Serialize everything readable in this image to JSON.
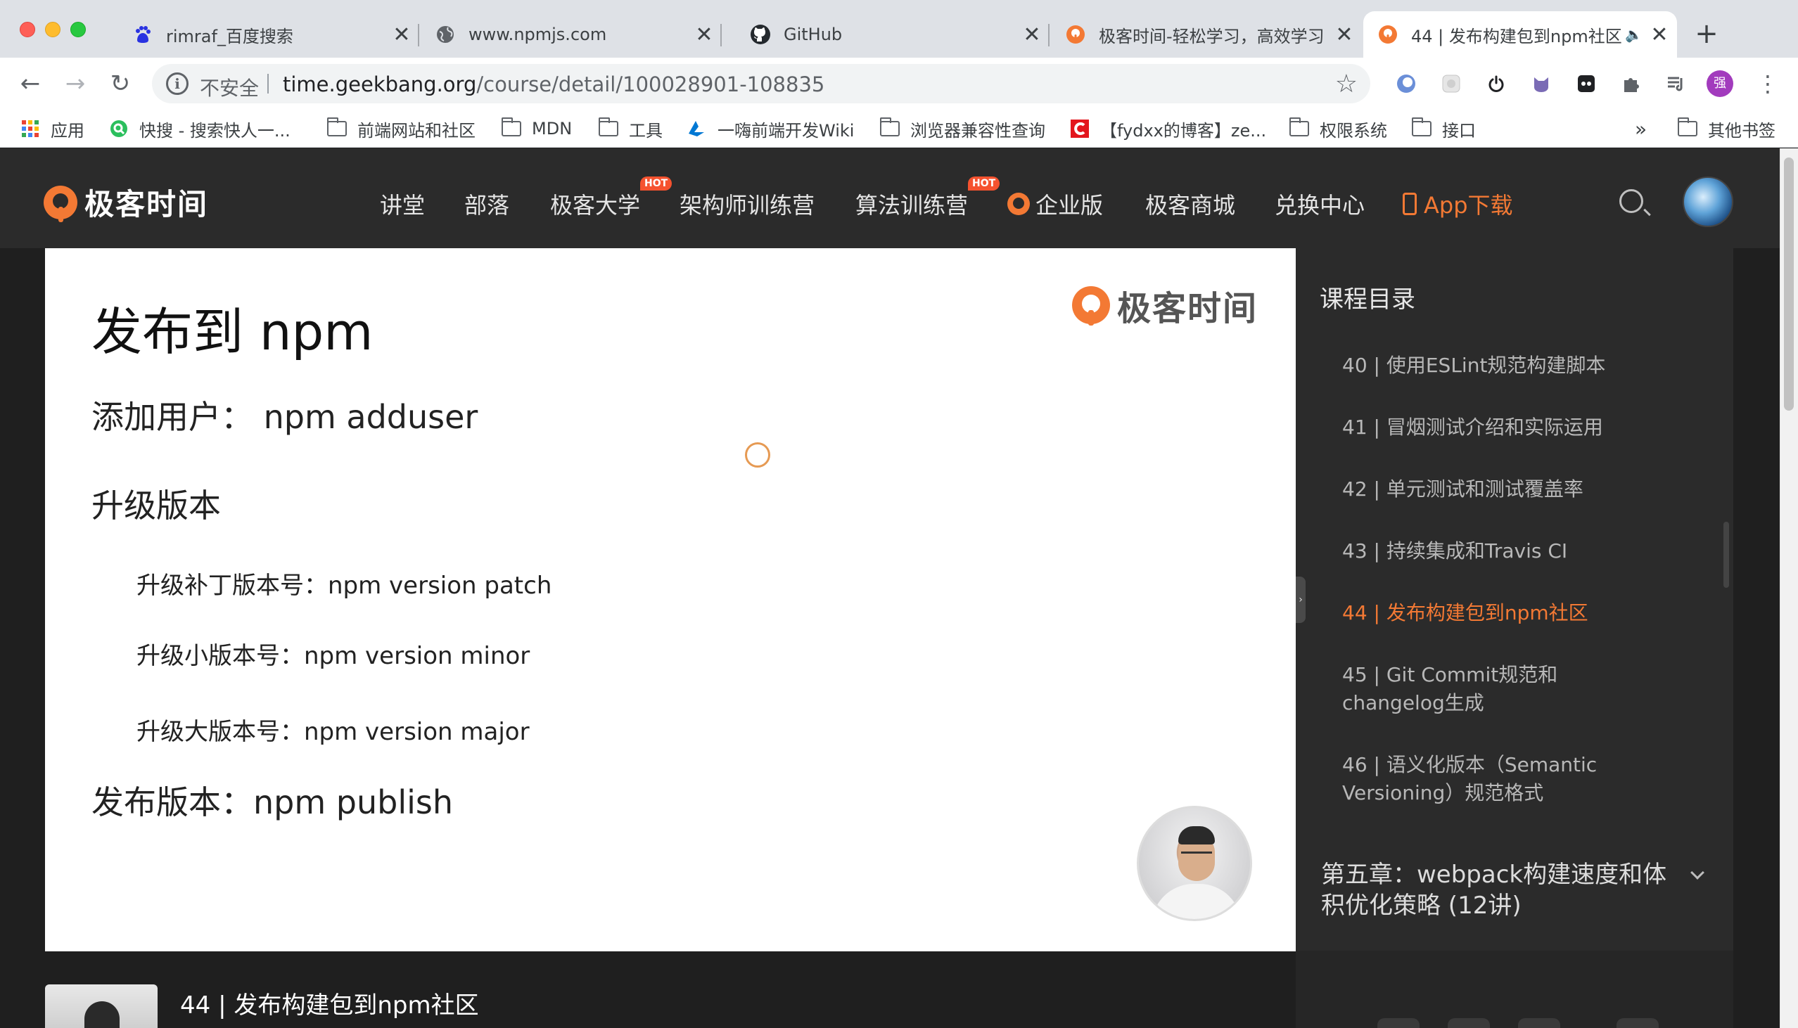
{
  "browser": {
    "tabs": [
      {
        "title": "rimraf_百度搜索",
        "icon": "baidu-paw-icon",
        "active": false
      },
      {
        "title": "www.npmjs.com",
        "icon": "globe-icon",
        "active": false
      },
      {
        "title": "GitHub",
        "icon": "github-icon",
        "active": false
      },
      {
        "title": "极客时间-轻松学习，高效学习",
        "icon": "geektime-icon",
        "active": false
      },
      {
        "title": "44 | 发布构建包到npm社区",
        "icon": "geektime-icon",
        "active": true
      }
    ],
    "new_tab": "+",
    "close_glyph": "✕",
    "nav": {
      "back": "←",
      "forward": "→",
      "reload": "↻"
    },
    "omnibox": {
      "security_label": "不安全",
      "host": "time.geekbang.org",
      "path": "/course/detail/100028901-108835"
    },
    "profile_initial": "强",
    "bookmarks": [
      {
        "label": "应用",
        "icon": "apps-grid-icon"
      },
      {
        "label": "快搜 - 搜索快人一...",
        "icon": "kuaisou-icon"
      },
      {
        "label": "前端网站和社区",
        "icon": "folder-icon"
      },
      {
        "label": "MDN",
        "icon": "folder-icon"
      },
      {
        "label": "工具",
        "icon": "folder-icon"
      },
      {
        "label": "一嗨前端开发Wiki",
        "icon": "azure-icon"
      },
      {
        "label": "浏览器兼容性查询",
        "icon": "folder-icon"
      },
      {
        "label": "【fydxx的博客】ze...",
        "icon": "csdn-icon"
      },
      {
        "label": "权限系统",
        "icon": "folder-icon"
      },
      {
        "label": "接口",
        "icon": "folder-icon"
      }
    ],
    "bookmarks_overflow": "»",
    "other_bookmarks": "其他书签"
  },
  "site": {
    "logo_text": "极客时间",
    "nav": [
      {
        "label": "讲堂"
      },
      {
        "label": "部落"
      },
      {
        "label": "极客大学",
        "badge": "HOT"
      },
      {
        "label": "架构师训练营"
      },
      {
        "label": "算法训练营",
        "badge": "HOT"
      },
      {
        "label": "企业版"
      },
      {
        "label": "极客商城"
      },
      {
        "label": "兑换中心"
      },
      {
        "label": "App下载"
      }
    ],
    "accent_color": "#f37934"
  },
  "slide": {
    "title": "发布到 npm",
    "logo_text": "极客时间",
    "lines": [
      "添加用户：  npm adduser",
      "升级版本",
      "升级补丁版本号：npm version patch",
      "升级小版本号：npm version minor",
      "升级大版本号：npm version major",
      "发布版本：npm publish"
    ]
  },
  "below_video": {
    "title": "44 | 发布构建包到npm社区"
  },
  "sidebar": {
    "title": "课程目录",
    "lessons": [
      {
        "text": "40 | 使用ESLint规范构建脚本",
        "active": false
      },
      {
        "text": "41 | 冒烟测试介绍和实际运用",
        "active": false
      },
      {
        "text": "42 | 单元测试和测试覆盖率",
        "active": false
      },
      {
        "text": "43 | 持续集成和Travis CI",
        "active": false
      },
      {
        "text": "44 | 发布构建包到npm社区",
        "active": true
      },
      {
        "text": "45 | Git Commit规范和changelog生成",
        "active": false
      },
      {
        "text": "46 | 语义化版本（Semantic Versioning）规范格式",
        "active": false
      }
    ],
    "chapter": "第五章：webpack构建速度和体积优化策略 (12讲)"
  }
}
